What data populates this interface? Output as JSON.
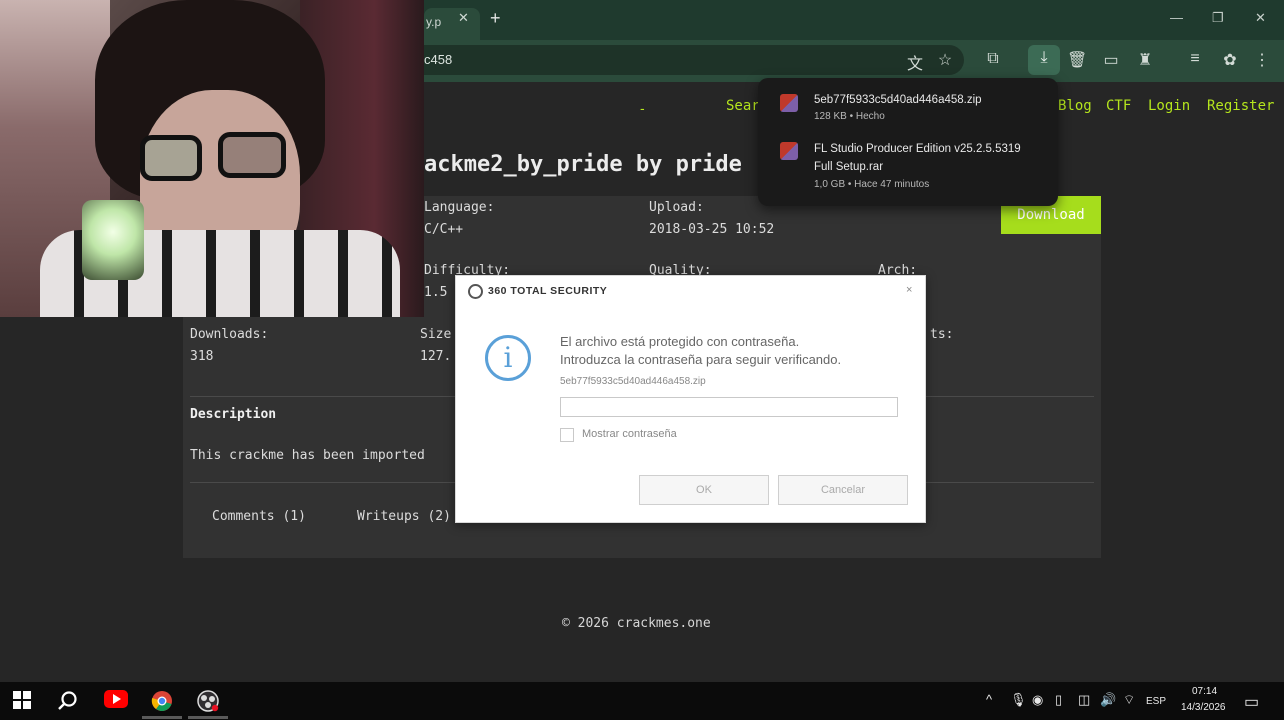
{
  "browser": {
    "tab_title": "y.p",
    "tab_close": "✕",
    "new_tab": "+",
    "url": "c458",
    "window_controls": {
      "minimize": "—",
      "maximize": "❐",
      "close": "✕"
    },
    "toolbar_icons": [
      "translate-icon",
      "star-icon",
      "extensions-icon",
      "download-icon",
      "trash-icon",
      "cast-icon",
      "extension-icon",
      "reading-list-icon",
      "profile-icon",
      "menu-icon"
    ]
  },
  "site": {
    "nav": {
      "dot": "-",
      "search": "Sear",
      "blog": "Blog",
      "ctf": "CTF",
      "login": "Login",
      "register": "Register"
    },
    "title": "ackme2_by_pride by pride",
    "fields": {
      "language_label": "Language:",
      "language_value": "C/C++",
      "upload_label": "Upload:",
      "upload_value": "2018-03-25 10:52",
      "difficulty_label": "Difficulty:",
      "difficulty_value": "1.5",
      "quality_label": "Quality:",
      "arch_label": "Arch:",
      "downloads_label": "Downloads:",
      "downloads_value": "318",
      "size_label": "Size",
      "size_value": "127.",
      "comments_label_partial": "ts:"
    },
    "download_button": "Download",
    "description_heading": "Description",
    "description_text": "This crackme has been imported",
    "tabs": {
      "comments": "Comments (1)",
      "writeups": "Writeups (2)"
    },
    "footer": "© 2026 crackmes.one"
  },
  "downloads_panel": {
    "items": [
      {
        "name": "5eb77f5933c5d40ad446a458.zip",
        "meta": "128 KB • Hecho"
      },
      {
        "name": "FL Studio Producer Edition v25.2.5.5319",
        "name2": "Full Setup.rar",
        "meta": "1,0 GB • Hace 47 minutos"
      }
    ]
  },
  "dialog": {
    "title": "360 TOTAL SECURITY",
    "close": "×",
    "icon": "i",
    "line1": "El archivo está protegido con contraseña.",
    "line2": "Introduzca la contraseña para seguir verificando.",
    "file": "5eb77f5933c5d40ad446a458.zip",
    "password_value": "",
    "show_password_label": "Mostrar contraseña",
    "ok": "OK",
    "cancel": "Cancelar"
  },
  "taskbar": {
    "icons": [
      "windows-start-icon",
      "search-icon",
      "youtube-icon",
      "chrome-icon",
      "obs-icon"
    ],
    "tray": {
      "chevron": "^",
      "lang": "ESP"
    },
    "time": "07:14",
    "date": "14/3/2026"
  },
  "colors": {
    "accent_green": "#b5e61d",
    "download_green": "#a6dd1c",
    "chrome_dark": "#1f3a2e",
    "info_blue": "#5aa0d8"
  }
}
